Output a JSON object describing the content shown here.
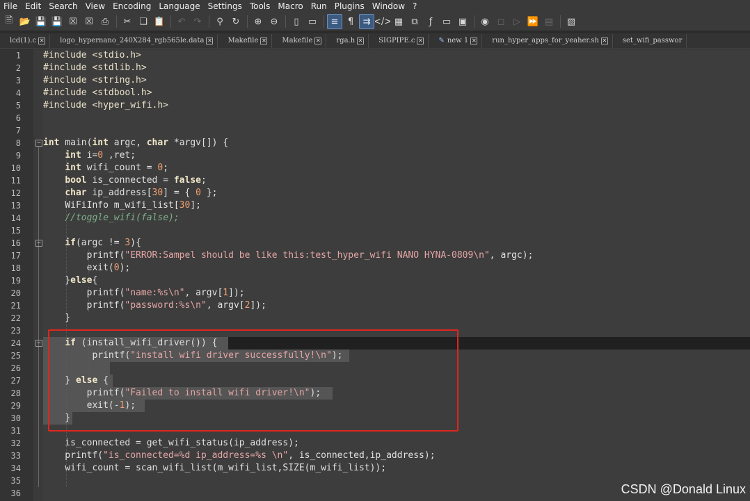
{
  "menu": [
    "File",
    "Edit",
    "Search",
    "View",
    "Encoding",
    "Language",
    "Settings",
    "Tools",
    "Macro",
    "Run",
    "Plugins",
    "Window",
    "?"
  ],
  "toolbar": {
    "icons": [
      "new-file-icon",
      "open-file-icon",
      "save-icon",
      "save-all-icon",
      "close-icon",
      "close-all-icon",
      "print-icon",
      "cut-icon",
      "copy-icon",
      "paste-icon",
      "undo-icon",
      "redo-icon",
      "find-icon",
      "replace-icon",
      "zoom-in-icon",
      "zoom-out-icon",
      "sync-vertical-icon",
      "sync-horizontal-icon",
      "word-wrap-icon",
      "show-all-chars-icon",
      "indent-guide-icon",
      "xml-tag-icon",
      "document-map-icon",
      "function-list-icon",
      "folder-workspace-icon",
      "monitor-icon",
      "record-macro-icon",
      "stop-macro-icon",
      "play-macro-icon",
      "run-macro-multiple-icon",
      "save-macro-icon",
      "spell-check-icon"
    ]
  },
  "tabs": [
    {
      "label": "lcd(1).c"
    },
    {
      "label": "logo_hypernano_240X284_rgb565le.data"
    },
    {
      "label": "Makefile"
    },
    {
      "label": "Makefile"
    },
    {
      "label": "rga.h"
    },
    {
      "label": "SIGPIPE.c"
    },
    {
      "label": "new 1"
    },
    {
      "label": "run_hyper_apps_for_yeaher.sh"
    },
    {
      "label": "set_wifi_passwor"
    }
  ],
  "line_numbers": [
    "1",
    "2",
    "3",
    "4",
    "5",
    "6",
    "7",
    "8",
    "9",
    "10",
    "11",
    "12",
    "13",
    "14",
    "15",
    "16",
    "17",
    "18",
    "19",
    "20",
    "21",
    "22",
    "23",
    "24",
    "25",
    "26",
    "27",
    "28",
    "29",
    "30",
    "31",
    "32",
    "33",
    "34",
    "35",
    "36"
  ],
  "code": {
    "l1": [
      "#include <stdio.h>"
    ],
    "l2": [
      "#include <stdlib.h>"
    ],
    "l3": [
      "#include <string.h>"
    ],
    "l4": [
      "#include <stdbool.h>"
    ],
    "l5": [
      "#include <hyper_wifi.h>"
    ],
    "l8": [
      "int",
      " main(",
      "int",
      " argc, ",
      "char",
      " *argv[]) {"
    ],
    "l9": [
      "    ",
      "int",
      " i=",
      "0",
      " ,ret;"
    ],
    "l10": [
      "    ",
      "int",
      " wifi_count = ",
      "0",
      ";"
    ],
    "l11": [
      "    ",
      "bool",
      " is_connected = ",
      "false",
      ";"
    ],
    "l12": [
      "    ",
      "char",
      " ip_address[",
      "30",
      "] = { ",
      "0",
      " };"
    ],
    "l13": [
      "    WiFiInfo m_wifi_list[",
      "30",
      "];"
    ],
    "l14": [
      "    ",
      "//toggle_wifi(false);"
    ],
    "l16": [
      "    ",
      "if",
      "(argc != ",
      "3",
      "){"
    ],
    "l17": [
      "        printf(",
      "\"ERROR:Sampel should be like this:test_hyper_wifi NANO HYNA-0809\\n\"",
      ", argc);"
    ],
    "l18": [
      "        exit(",
      "0",
      ");"
    ],
    "l19": [
      "    }",
      "else",
      "{"
    ],
    "l20": [
      "        printf(",
      "\"name:%s\\n\"",
      ", argv[",
      "1",
      "]);"
    ],
    "l21": [
      "        printf(",
      "\"password:%s\\n\"",
      ", argv[",
      "2",
      "]);"
    ],
    "l22": [
      "    }"
    ],
    "l24": [
      "    ",
      "if",
      " (install_wifi_driver()) {"
    ],
    "l25": [
      "         printf(",
      "\"install wifi driver successfully!\\n\"",
      ");"
    ],
    "l27": [
      "    } ",
      "else",
      " {"
    ],
    "l28": [
      "        printf(",
      "\"Failed to install wifi driver!\\n\"",
      ");"
    ],
    "l29": [
      "        exit(-",
      "1",
      ");"
    ],
    "l30": [
      "    }"
    ],
    "l32": [
      "    is_connected = get_wifi_status(ip_address);"
    ],
    "l33": [
      "    printf(",
      "\"is_connected=%d ip_address=%s \\n\"",
      ", is_connected,ip_address);"
    ],
    "l34": [
      "    wifi_count = scan_wifi_list(m_wifi_list,SIZE(m_wifi_list));"
    ]
  },
  "watermark": "CSDN @Donald Linux",
  "colors": {
    "highlight_box": "#e0261f",
    "keyword": "#f0e6c8",
    "string": "#e5a5a5",
    "number": "#f0a070",
    "comment": "#7fb089"
  }
}
